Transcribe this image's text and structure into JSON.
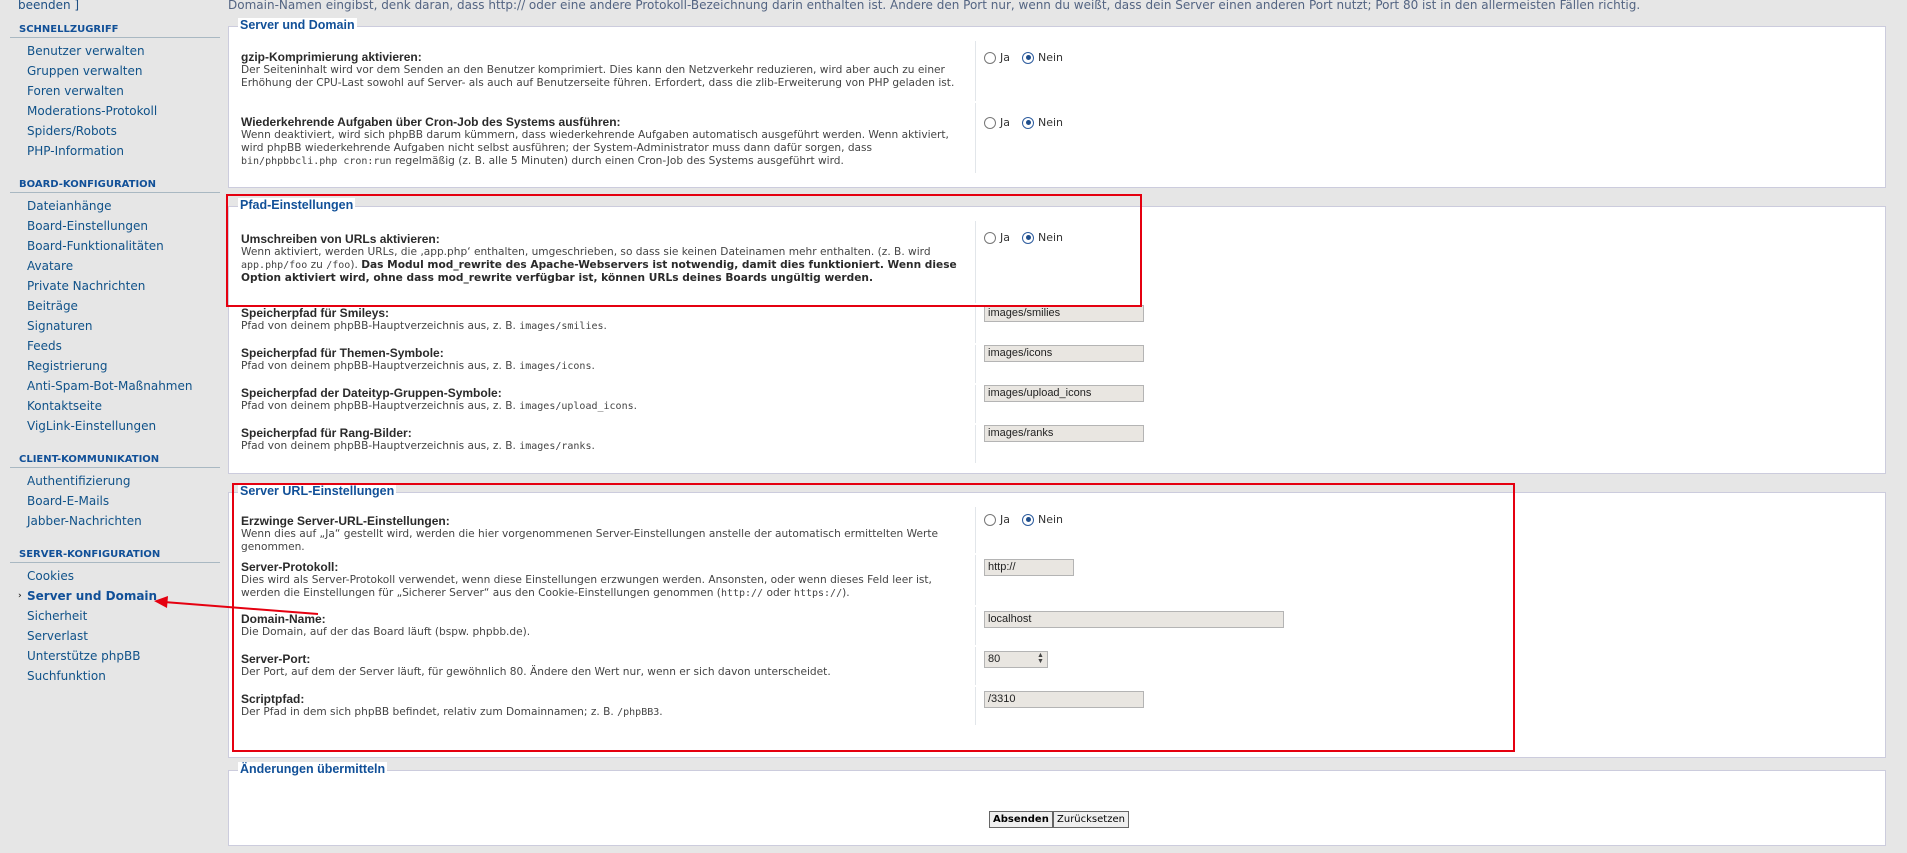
{
  "top": {
    "beenden": "beenden ]",
    "info_text": "Domain-Namen eingibst, denk daran, dass http:// oder eine andere Protokoll-Bezeichnung darin enthalten ist. Ändere den Port nur, wenn du weißt, dass dein Server einen anderen Port nutzt; Port 80 ist in den allermeisten Fällen richtig."
  },
  "sidebar": {
    "sections": [
      {
        "heading": "SCHNELLZUGRIFF",
        "items": [
          "Benutzer verwalten",
          "Gruppen verwalten",
          "Foren verwalten",
          "Moderations-Protokoll",
          "Spiders/Robots",
          "PHP-Information"
        ]
      },
      {
        "heading": "BOARD-KONFIGURATION",
        "items": [
          "Dateianhänge",
          "Board-Einstellungen",
          "Board-Funktionalitäten",
          "Avatare",
          "Private Nachrichten",
          "Beiträge",
          "Signaturen",
          "Feeds",
          "Registrierung",
          "Anti-Spam-Bot-Maßnahmen",
          "Kontaktseite",
          "VigLink-Einstellungen"
        ]
      },
      {
        "heading": "CLIENT-KOMMUNIKATION",
        "items": [
          "Authentifizierung",
          "Board-E-Mails",
          "Jabber-Nachrichten"
        ]
      },
      {
        "heading": "SERVER-KONFIGURATION",
        "items": [
          "Cookies",
          "Server und Domain",
          "Sicherheit",
          "Serverlast",
          "Unterstütze phpBB",
          "Suchfunktion"
        ]
      }
    ],
    "active_item": "Server und Domain"
  },
  "radio": {
    "yes": "Ja",
    "no": "Nein"
  },
  "server_domain": {
    "legend": "Server und Domain",
    "gzip_title": "gzip-Komprimierung aktivieren:",
    "gzip_desc": "Der Seiteninhalt wird vor dem Senden an den Benutzer komprimiert. Dies kann den Netzverkehr reduzieren, wird aber auch zu einer Erhöhung der CPU-Last sowohl auf Server- als auch auf Benutzerseite führen. Erfordert, dass die zlib-Erweiterung von PHP geladen ist.",
    "cron_title": "Wiederkehrende Aufgaben über Cron-Job des Systems ausführen:",
    "cron_desc_1": "Wenn deaktiviert, wird sich phpBB darum kümmern, dass wiederkehrende Aufgaben automatisch ausgeführt werden. Wenn aktiviert, wird phpBB wiederkehrende Aufgaben nicht selbst ausführen; der System-Administrator muss dann dafür sorgen, dass ",
    "cron_desc_code": "bin/phpbbcli.php cron:run",
    "cron_desc_2": " regelmäßig (z. B. alle 5 Minuten) durch einen Cron-Job des Systems ausgeführt wird."
  },
  "path": {
    "legend": "Pfad-Einstellungen",
    "rewrite_title": "Umschreiben von URLs aktivieren:",
    "rewrite_desc_1": "Wenn aktiviert, werden URLs, die ‚app.php‘ enthalten, umgeschrieben, so dass sie keinen Dateinamen mehr enthalten. (z. B. wird ",
    "rewrite_desc_code1": "app.php/foo",
    "rewrite_desc_2": " zu ",
    "rewrite_desc_code2": "/foo",
    "rewrite_desc_3": "). ",
    "rewrite_desc_bold": "Das Modul mod_rewrite des Apache-Webservers ist notwendig, damit dies funktioniert. Wenn diese Option aktiviert wird, ohne dass mod_rewrite verfügbar ist, können URLs deines Boards ungültig werden.",
    "smilies_title": "Speicherpfad für Smileys:",
    "smilies_desc_1": "Pfad von deinem phpBB-Hauptverzeichnis aus, z. B. ",
    "smilies_desc_code": "images/smilies",
    "smilies_value": "images/smilies",
    "icons_title": "Speicherpfad für Themen-Symbole:",
    "icons_desc_1": "Pfad von deinem phpBB-Hauptverzeichnis aus, z. B. ",
    "icons_desc_code": "images/icons",
    "icons_value": "images/icons",
    "upload_title": "Speicherpfad der Dateityp-Gruppen-Symbole:",
    "upload_desc_1": "Pfad von deinem phpBB-Hauptverzeichnis aus, z. B. ",
    "upload_desc_code": "images/upload_icons",
    "upload_value": "images/upload_icons",
    "ranks_title": "Speicherpfad für Rang-Bilder:",
    "ranks_desc_1": "Pfad von deinem phpBB-Hauptverzeichnis aus, z. B. ",
    "ranks_desc_code": "images/ranks",
    "ranks_value": "images/ranks",
    "period": "."
  },
  "server_url": {
    "legend": "Server URL-Einstellungen",
    "force_title": "Erzwinge Server-URL-Einstellungen:",
    "force_desc": "Wenn dies auf „Ja“ gestellt wird, werden die hier vorgenommenen Server-Einstellungen anstelle der automatisch ermittelten Werte genommen.",
    "protocol_title": "Server-Protokoll:",
    "protocol_desc_1": "Dies wird als Server-Protokoll verwendet, wenn diese Einstellungen erzwungen werden. Ansonsten, oder wenn dieses Feld leer ist, werden die Einstellungen für „Sicherer Server“ aus den Cookie-Einstellungen genommen (",
    "protocol_desc_code1": "http://",
    "protocol_desc_2": " oder ",
    "protocol_desc_code2": "https://",
    "protocol_desc_3": ").",
    "protocol_value": "http://",
    "domain_title": "Domain-Name:",
    "domain_desc": "Die Domain, auf der das Board läuft (bspw. phpbb.de).",
    "domain_value": "localhost",
    "port_title": "Server-Port:",
    "port_desc": "Der Port, auf dem der Server läuft, für gewöhnlich 80. Ändere den Wert nur, wenn er sich davon unterscheidet.",
    "port_value": "80",
    "script_title": "Scriptpfad:",
    "script_desc_1": "Der Pfad in dem sich phpBB befindet, relativ zum Domainnamen; z. B. ",
    "script_desc_code": "/phpBB3",
    "script_desc_2": ".",
    "script_value": "/3310"
  },
  "submit": {
    "legend": "Änderungen übermitteln",
    "submit_label": "Absenden",
    "reset_label": "Zurücksetzen"
  },
  "colors": {
    "annotation": "#e50010",
    "heading": "#115098",
    "link": "#105289"
  }
}
